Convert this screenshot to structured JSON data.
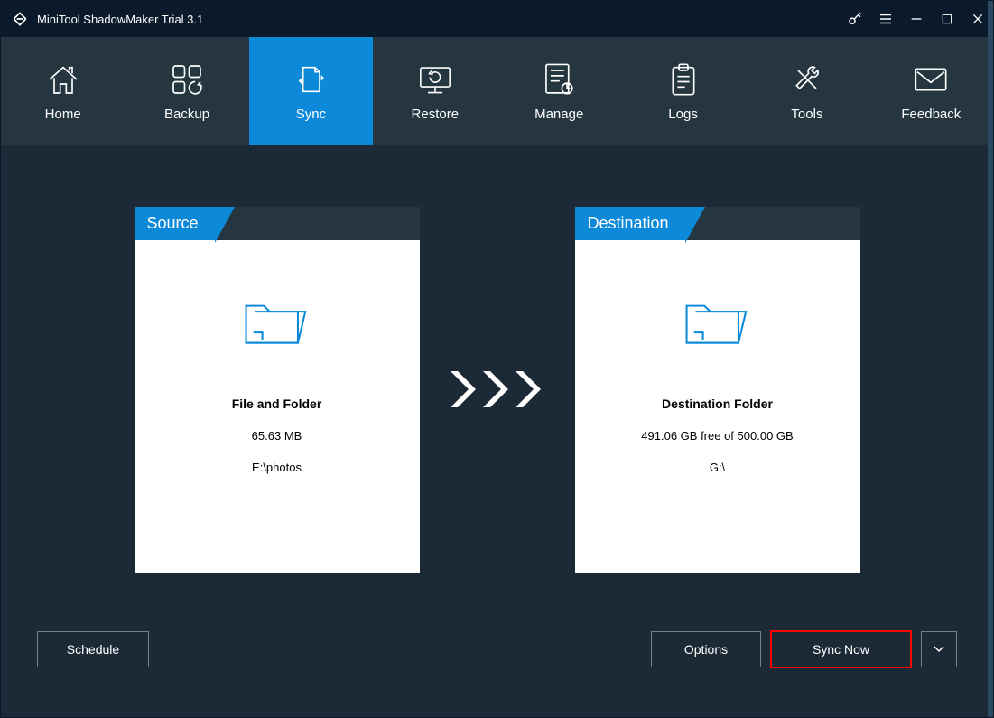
{
  "window": {
    "title": "MiniTool ShadowMaker Trial 3.1"
  },
  "nav": {
    "home": "Home",
    "backup": "Backup",
    "sync": "Sync",
    "restore": "Restore",
    "manage": "Manage",
    "logs": "Logs",
    "tools": "Tools",
    "feedback": "Feedback"
  },
  "source": {
    "header": "Source",
    "title": "File and Folder",
    "size": "65.63 MB",
    "path": "E:\\photos"
  },
  "destination": {
    "header": "Destination",
    "title": "Destination Folder",
    "free": "491.06 GB free of 500.00 GB",
    "path": "G:\\"
  },
  "buttons": {
    "schedule": "Schedule",
    "options": "Options",
    "syncnow": "Sync Now"
  }
}
